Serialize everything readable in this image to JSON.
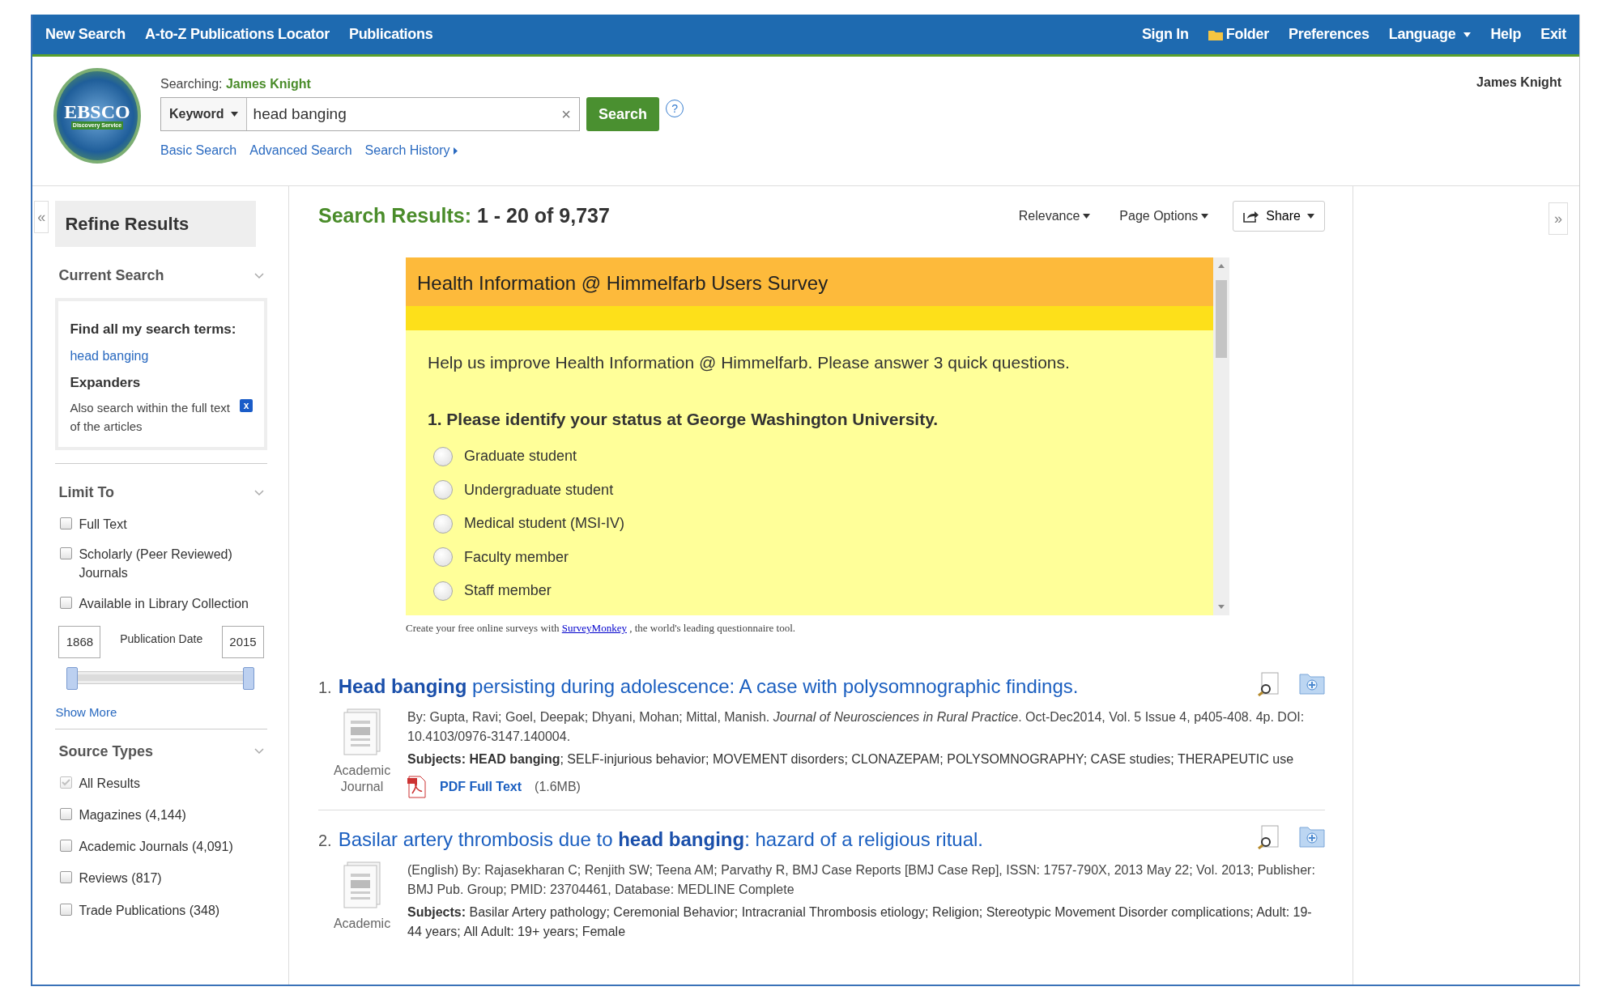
{
  "topnav": {
    "left": [
      "New Search",
      "A-to-Z Publications Locator",
      "Publications"
    ],
    "right": [
      {
        "label": "Sign In",
        "kind": "link"
      },
      {
        "label": "Folder",
        "kind": "folder"
      },
      {
        "label": "Preferences",
        "kind": "link"
      },
      {
        "label": "Language",
        "kind": "dropdown"
      },
      {
        "label": "Help",
        "kind": "link"
      },
      {
        "label": "Exit",
        "kind": "link"
      }
    ]
  },
  "logo": {
    "top": "EBSCO",
    "bottom": "Discovery Service"
  },
  "search": {
    "searching_label": "Searching:",
    "searching_value": "James Knight",
    "field_type": "Keyword",
    "query": "head banging",
    "clear": "×",
    "button": "Search",
    "help": "?",
    "links": [
      {
        "label": "Basic Search",
        "kind": "link"
      },
      {
        "label": "Advanced Search",
        "kind": "link"
      },
      {
        "label": "Search History",
        "kind": "history"
      }
    ]
  },
  "user": "James Knight",
  "sidebar": {
    "collapse": "«",
    "title": "Refine Results",
    "current_search": {
      "heading": "Current Search",
      "find_label": "Find all my search terms:",
      "term": "head banging",
      "expanders_label": "Expanders",
      "expander": "Also search within the full text of the articles",
      "remove": "x"
    },
    "limit_to": {
      "heading": "Limit To",
      "options": [
        {
          "label": "Full Text",
          "checked": false
        },
        {
          "label": "Scholarly (Peer Reviewed) Journals",
          "checked": false
        },
        {
          "label": "Available in Library Collection",
          "checked": false
        }
      ],
      "date": {
        "from": "1868",
        "label": "Publication Date",
        "to": "2015",
        "level": 1
      },
      "show_more": "Show More"
    },
    "source_types": {
      "heading": "Source Types",
      "options": [
        {
          "label": "All Results",
          "checked": true,
          "disabled": true
        },
        {
          "label": "Magazines",
          "count": "(4,144)",
          "checked": false,
          "disabled": false
        },
        {
          "label": "Academic Journals",
          "count": "(4,091)",
          "checked": false,
          "disabled": false
        },
        {
          "label": "Reviews",
          "count": "(817)",
          "checked": false,
          "disabled": false
        },
        {
          "label": "Trade Publications",
          "count": "(348)",
          "checked": false,
          "disabled": false
        }
      ]
    }
  },
  "results_header": {
    "label": "Search Results:",
    "range": "1 - 20 of 9,737",
    "sort": "Relevance",
    "page_options": "Page Options",
    "share": "Share"
  },
  "expand": "»",
  "survey": {
    "title": "Health Information @ Himmelfarb Users Survey",
    "intro": "Help us improve Health Information @ Himmelfarb. Please answer 3 quick questions.",
    "question": "1. Please identify your status at George Washington University.",
    "choices": [
      {
        "label": "Graduate student",
        "selected": false
      },
      {
        "label": "Undergraduate student",
        "selected": false
      },
      {
        "label": "Medical student (MSI-IV)",
        "selected": false
      },
      {
        "label": "Faculty member",
        "selected": false
      },
      {
        "label": "Staff member",
        "selected": false
      }
    ],
    "footer_pre": "Create your free online surveys with",
    "footer_link": "SurveyMonkey",
    "footer_post": ", the world's leading questionnaire tool."
  },
  "results": [
    {
      "number": "1.",
      "title": "**Head banging** persisting during adolescence: A case with polysomnographic findings.",
      "meta": "By: Gupta, Ravi; Goel, Deepak; Dhyani, Mohan; Mittal, Manish. *Journal of Neurosciences in Rural Practice*. Oct-Dec2014, Vol. 5 Issue 4, p405-408. 4p. DOI: 10.4103/0976-3147.140004.",
      "subjects": "**Subjects: HEAD banging**; SELF-injurious behavior; MOVEMENT disorders; CLONAZEPAM; POLYSOMNOGRAPHY; CASE studies; THERAPEUTIC use",
      "type": "Academic Journal",
      "pdf": "PDF Full Text",
      "pdf_size": "(1.6MB)"
    },
    {
      "number": "2.",
      "title": "Basilar artery thrombosis due to **head banging**: hazard of a religious ritual.",
      "meta": "(English) By: Rajasekharan C; Renjith SW; Teena AM; Parvathy R, BMJ Case Reports [BMJ Case Rep], ISSN: 1757-790X, 2013 May 22; Vol. 2013; Publisher: BMJ Pub. Group; PMID: 23704461, Database: MEDLINE Complete",
      "subjects": "**Subjects:** Basilar Artery pathology; Ceremonial Behavior; Intracranial Thrombosis etiology; Religion; Stereotypic Movement Disorder complications; Adult: 19-44 years; All Adult: 19+ years; Female",
      "type": "Academic"
    }
  ]
}
